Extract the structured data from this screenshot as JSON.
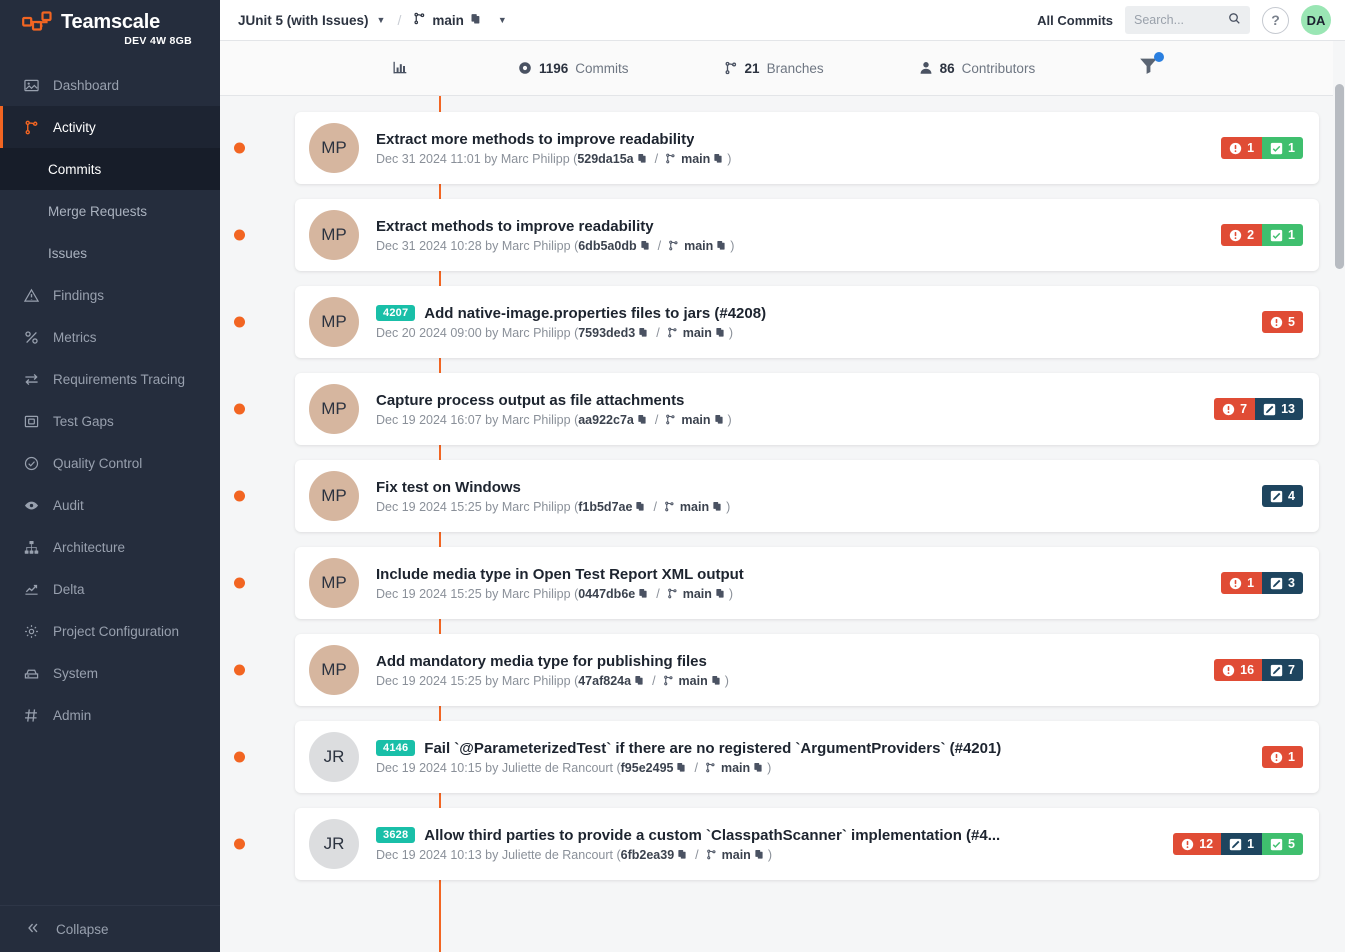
{
  "sidebar": {
    "brand": {
      "name": "Teamscale",
      "subtitle": "DEV 4W 8GB",
      "logo_icon": "teamscale-logo-icon"
    },
    "items": [
      {
        "label": "Dashboard",
        "icon": "dashboard-icon",
        "active": false
      },
      {
        "label": "Activity",
        "icon": "branch-icon",
        "active": true
      },
      {
        "label": "Findings",
        "icon": "warning-triangle-icon",
        "active": false
      },
      {
        "label": "Metrics",
        "icon": "percent-icon",
        "active": false
      },
      {
        "label": "Requirements Tracing",
        "icon": "exchange-arrows-icon",
        "active": false
      },
      {
        "label": "Test Gaps",
        "icon": "test-gap-icon",
        "active": false
      },
      {
        "label": "Quality Control",
        "icon": "check-circle-icon",
        "active": false
      },
      {
        "label": "Audit",
        "icon": "eye-icon",
        "active": false
      },
      {
        "label": "Architecture",
        "icon": "sitemap-icon",
        "active": false
      },
      {
        "label": "Delta",
        "icon": "chart-line-icon",
        "active": false
      },
      {
        "label": "Project Configuration",
        "icon": "gear-icon",
        "active": false
      },
      {
        "label": "System",
        "icon": "server-icon",
        "active": false
      },
      {
        "label": "Admin",
        "icon": "hash-icon",
        "active": false
      }
    ],
    "subitems": [
      {
        "label": "Commits",
        "selected": true
      },
      {
        "label": "Merge Requests",
        "selected": false
      },
      {
        "label": "Issues",
        "selected": false
      }
    ],
    "collapse": {
      "label": "Collapse",
      "icon": "double-chevron-left-icon"
    }
  },
  "topbar": {
    "project": "JUnit 5 (with Issues)",
    "separator": "/",
    "branch": "main",
    "branch_icon": "branch-icon",
    "copy_icon": "copy-icon",
    "all_commits": "All Commits",
    "search": {
      "placeholder": "Search...",
      "value": "",
      "icon": "search-icon"
    },
    "help_label": "?",
    "user_initials": "DA"
  },
  "statsbar": {
    "chart_icon": "bar-chart-icon",
    "stats": [
      {
        "count": "1196",
        "label": "Commits",
        "icon": "commit-dot-icon"
      },
      {
        "count": "21",
        "label": "Branches",
        "icon": "branch-icon"
      },
      {
        "count": "86",
        "label": "Contributors",
        "icon": "user-icon"
      }
    ],
    "filter_icon": "filter-icon",
    "filter_active": true
  },
  "colors": {
    "accent_orange": "#f26522",
    "sidebar_bg": "#252d3d",
    "badge_red": "#e04c35",
    "badge_green": "#3fbf6e",
    "badge_navy": "#1e455f",
    "issue_teal": "#19bfa8",
    "avatar_mp": "#d6b69f",
    "avatar_jr": "#dcdddf",
    "user_avatar": "#9ae6b4",
    "filter_dot_blue": "#2a7fe0"
  },
  "commits": [
    {
      "initials": "MP",
      "avatar_class": "av-mp",
      "issue": null,
      "title": "Extract more methods to improve readability",
      "date": "Dec 31 2024 11:01",
      "by": "by",
      "author": "Marc Philipp",
      "hash": "529da15a",
      "branch": "main",
      "badges": [
        {
          "type": "red",
          "icon": "exclamation-circle-icon",
          "count": "1"
        },
        {
          "type": "green",
          "icon": "checkbox-icon",
          "count": "1"
        }
      ]
    },
    {
      "initials": "MP",
      "avatar_class": "av-mp",
      "issue": null,
      "title": "Extract methods to improve readability",
      "date": "Dec 31 2024 10:28",
      "by": "by",
      "author": "Marc Philipp",
      "hash": "6db5a0db",
      "branch": "main",
      "badges": [
        {
          "type": "red",
          "icon": "exclamation-circle-icon",
          "count": "2"
        },
        {
          "type": "green",
          "icon": "checkbox-icon",
          "count": "1"
        }
      ]
    },
    {
      "initials": "MP",
      "avatar_class": "av-mp",
      "issue": "4207",
      "title": "Add native-image.properties files to jars (#4208)",
      "date": "Dec 20 2024 09:00",
      "by": "by",
      "author": "Marc Philipp",
      "hash": "7593ded3",
      "branch": "main",
      "badges": [
        {
          "type": "red",
          "icon": "exclamation-circle-icon",
          "count": "5"
        }
      ]
    },
    {
      "initials": "MP",
      "avatar_class": "av-mp",
      "issue": null,
      "title": "Capture process output as file attachments",
      "date": "Dec 19 2024 16:07",
      "by": "by",
      "author": "Marc Philipp",
      "hash": "aa922c7a",
      "branch": "main",
      "badges": [
        {
          "type": "red",
          "icon": "exclamation-circle-icon",
          "count": "7"
        },
        {
          "type": "navy",
          "icon": "pencil-square-icon",
          "count": "13"
        }
      ]
    },
    {
      "initials": "MP",
      "avatar_class": "av-mp",
      "issue": null,
      "title": "Fix test on Windows",
      "date": "Dec 19 2024 15:25",
      "by": "by",
      "author": "Marc Philipp",
      "hash": "f1b5d7ae",
      "branch": "main",
      "badges": [
        {
          "type": "navy",
          "icon": "pencil-square-icon",
          "count": "4"
        }
      ]
    },
    {
      "initials": "MP",
      "avatar_class": "av-mp",
      "issue": null,
      "title": "Include media type in Open Test Report XML output",
      "date": "Dec 19 2024 15:25",
      "by": "by",
      "author": "Marc Philipp",
      "hash": "0447db6e",
      "branch": "main",
      "badges": [
        {
          "type": "red",
          "icon": "exclamation-circle-icon",
          "count": "1"
        },
        {
          "type": "navy",
          "icon": "pencil-square-icon",
          "count": "3"
        }
      ]
    },
    {
      "initials": "MP",
      "avatar_class": "av-mp",
      "issue": null,
      "title": "Add mandatory media type for publishing files",
      "date": "Dec 19 2024 15:25",
      "by": "by",
      "author": "Marc Philipp",
      "hash": "47af824a",
      "branch": "main",
      "badges": [
        {
          "type": "red",
          "icon": "exclamation-circle-icon",
          "count": "16"
        },
        {
          "type": "navy",
          "icon": "pencil-square-icon",
          "count": "7"
        }
      ]
    },
    {
      "initials": "JR",
      "avatar_class": "av-jr",
      "issue": "4146",
      "title": "Fail `@ParameterizedTest` if there are no registered `ArgumentProviders` (#4201)",
      "date": "Dec 19 2024 10:15",
      "by": "by",
      "author": "Juliette de Rancourt",
      "hash": "f95e2495",
      "branch": "main",
      "badges": [
        {
          "type": "red",
          "icon": "exclamation-circle-icon",
          "count": "1"
        }
      ]
    },
    {
      "initials": "JR",
      "avatar_class": "av-jr",
      "issue": "3628",
      "title": "Allow third parties to provide a custom `ClasspathScanner` implementation (#4...",
      "date": "Dec 19 2024 10:13",
      "by": "by",
      "author": "Juliette de Rancourt",
      "hash": "6fb2ea39",
      "branch": "main",
      "badges": [
        {
          "type": "red",
          "icon": "exclamation-circle-icon",
          "count": "12"
        },
        {
          "type": "navy",
          "icon": "pencil-square-icon",
          "count": "1"
        },
        {
          "type": "green",
          "icon": "checkbox-icon",
          "count": "5"
        }
      ]
    }
  ]
}
